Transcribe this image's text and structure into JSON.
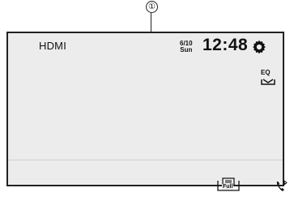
{
  "callout": {
    "number": "①"
  },
  "screen": {
    "source_label": "HDMI",
    "date": {
      "day": "6/10",
      "weekday": "Sun"
    },
    "time": "12:48"
  },
  "buttons": {
    "eq_label": "EQ",
    "full_label": "Full"
  },
  "icons": [
    "gear-icon",
    "eq-icon",
    "full-screen-icon",
    "bluetooth-phone-icon"
  ]
}
